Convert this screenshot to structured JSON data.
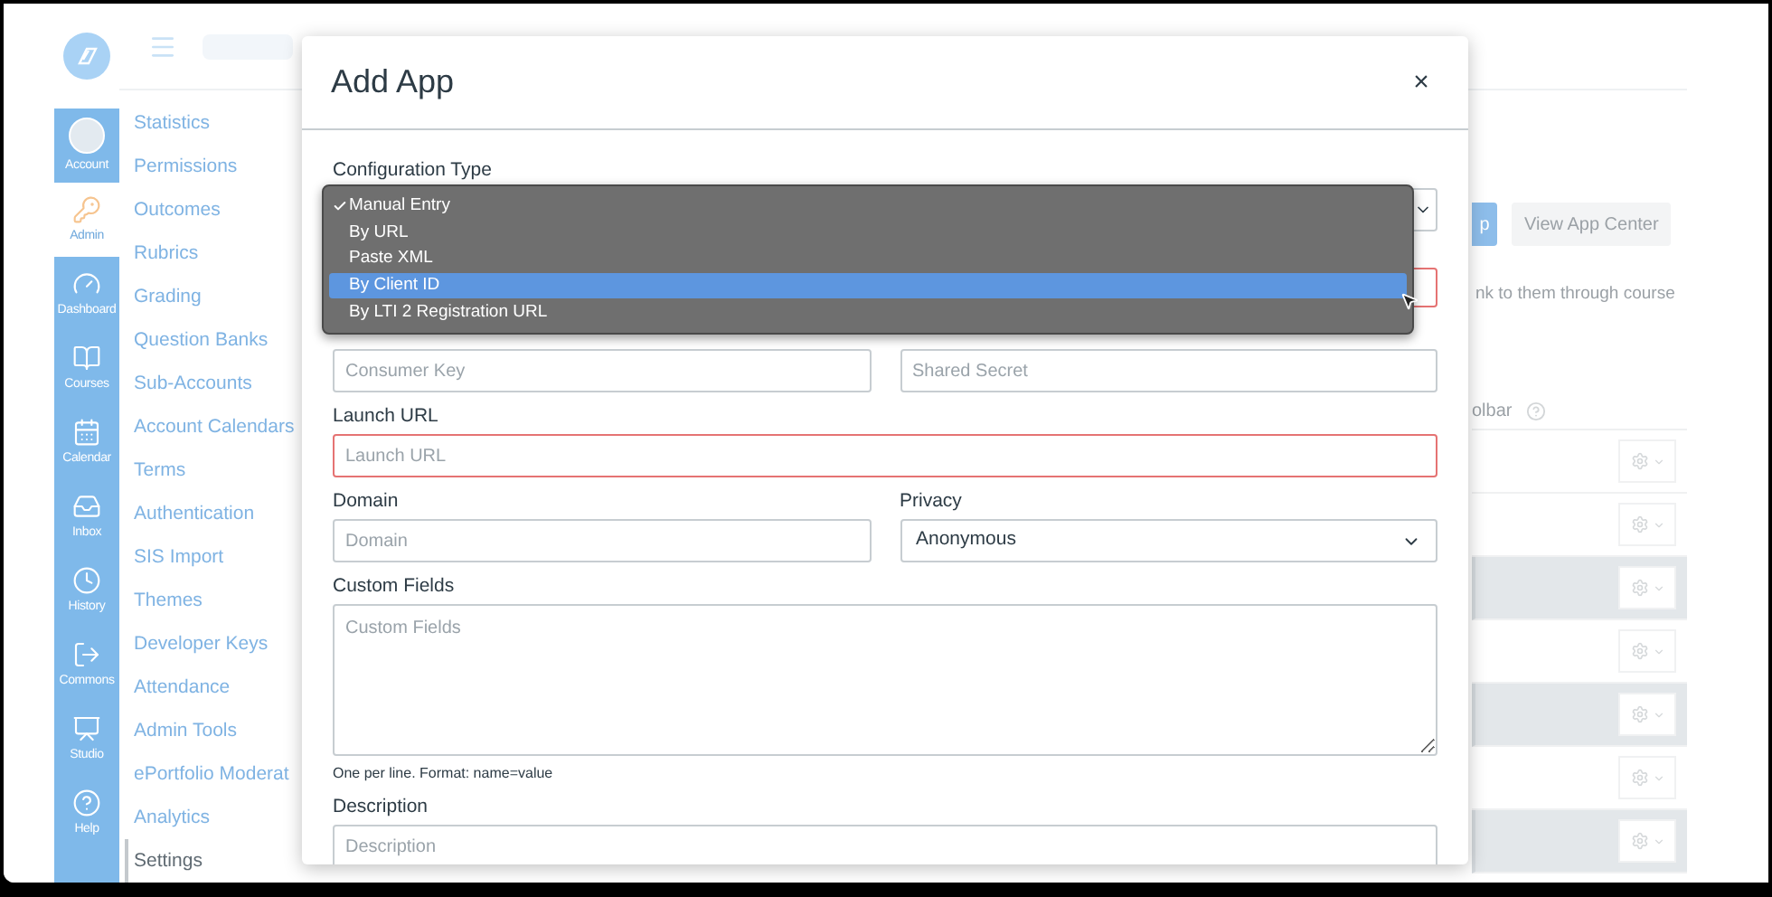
{
  "global_nav": [
    {
      "label": "Account",
      "selected": false
    },
    {
      "label": "Admin",
      "selected": true
    },
    {
      "label": "Dashboard",
      "selected": false
    },
    {
      "label": "Courses",
      "selected": false
    },
    {
      "label": "Calendar",
      "selected": false
    },
    {
      "label": "Inbox",
      "selected": false
    },
    {
      "label": "History",
      "selected": false
    },
    {
      "label": "Commons",
      "selected": false
    },
    {
      "label": "Studio",
      "selected": false
    },
    {
      "label": "Help",
      "selected": false
    }
  ],
  "account_nav": [
    {
      "label": "Statistics",
      "selected": false
    },
    {
      "label": "Permissions",
      "selected": false
    },
    {
      "label": "Outcomes",
      "selected": false
    },
    {
      "label": "Rubrics",
      "selected": false
    },
    {
      "label": "Grading",
      "selected": false
    },
    {
      "label": "Question Banks",
      "selected": false
    },
    {
      "label": "Sub-Accounts",
      "selected": false
    },
    {
      "label": "Account Calendars",
      "selected": false
    },
    {
      "label": "Terms",
      "selected": false
    },
    {
      "label": "Authentication",
      "selected": false
    },
    {
      "label": "SIS Import",
      "selected": false
    },
    {
      "label": "Themes",
      "selected": false
    },
    {
      "label": "Developer Keys",
      "selected": false
    },
    {
      "label": "Attendance",
      "selected": false
    },
    {
      "label": "Admin Tools",
      "selected": false
    },
    {
      "label": "ePortfolio Moderat",
      "selected": false
    },
    {
      "label": "Analytics",
      "selected": false
    },
    {
      "label": "Settings",
      "selected": true
    }
  ],
  "background": {
    "add_app_button": "p",
    "view_app_center_button": "View App Center",
    "intro_fragment": "nk to them through course",
    "column_heading_fragment": "olbar",
    "app_rows": [
      {
        "shaded": false
      },
      {
        "shaded": false
      },
      {
        "shaded": true
      },
      {
        "shaded": false
      },
      {
        "shaded": true
      },
      {
        "shaded": false
      },
      {
        "shaded": true
      }
    ]
  },
  "modal": {
    "title": "Add App",
    "close": "×",
    "configuration_type": {
      "label": "Configuration Type",
      "options": [
        {
          "label": "Manual Entry",
          "selected": true,
          "highlighted": false
        },
        {
          "label": "By URL",
          "selected": false,
          "highlighted": false
        },
        {
          "label": "Paste XML",
          "selected": false,
          "highlighted": false
        },
        {
          "label": "By Client ID",
          "selected": false,
          "highlighted": true
        },
        {
          "label": "By LTI 2 Registration URL",
          "selected": false,
          "highlighted": false
        }
      ]
    },
    "consumer_key": {
      "placeholder": "Consumer Key"
    },
    "shared_secret": {
      "placeholder": "Shared Secret"
    },
    "launch_url": {
      "label": "Launch URL",
      "placeholder": "Launch URL",
      "invalid": true
    },
    "domain": {
      "label": "Domain",
      "placeholder": "Domain"
    },
    "privacy": {
      "label": "Privacy",
      "value": "Anonymous"
    },
    "custom_fields": {
      "label": "Custom Fields",
      "placeholder": "Custom Fields",
      "hint": "One per line. Format: name=value"
    },
    "description": {
      "label": "Description",
      "placeholder": "Description"
    }
  }
}
